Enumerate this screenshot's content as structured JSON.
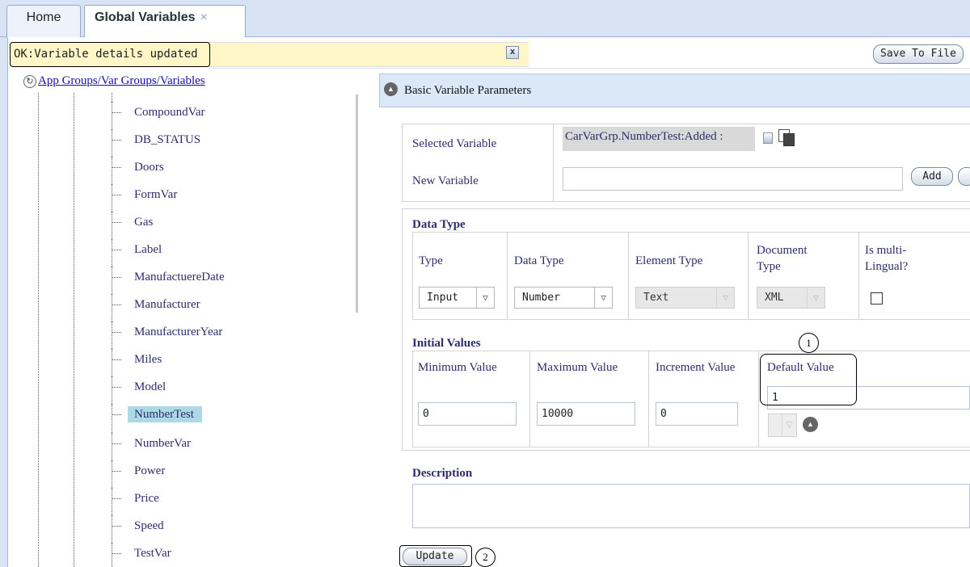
{
  "tabs": [
    {
      "label": "Home"
    },
    {
      "label": "Global Variables",
      "close": "×"
    }
  ],
  "status": {
    "message": "OK:Variable details updated",
    "dismiss": "x"
  },
  "toolbar": {
    "save_label": "Save To File"
  },
  "tree": {
    "root_label": "App Groups/Var Groups/Variables",
    "items": [
      {
        "label": "CompoundVar"
      },
      {
        "label": "DB_STATUS"
      },
      {
        "label": "Doors"
      },
      {
        "label": "FormVar"
      },
      {
        "label": "Gas"
      },
      {
        "label": "Label"
      },
      {
        "label": "ManufactuereDate"
      },
      {
        "label": "Manufacturer"
      },
      {
        "label": "ManufacturerYear"
      },
      {
        "label": "Miles"
      },
      {
        "label": "Model"
      },
      {
        "label": "NumberTest",
        "selected": true
      },
      {
        "label": "NumberVar"
      },
      {
        "label": "Power"
      },
      {
        "label": "Price"
      },
      {
        "label": "Speed"
      },
      {
        "label": "TestVar"
      }
    ]
  },
  "panel": {
    "title": "Basic Variable Parameters",
    "selected_variable_label": "Selected Variable",
    "selected_variable_value": "CarVarGrp.NumberTest:Added :",
    "new_variable_label": "New Variable",
    "new_variable_value": "",
    "add_label": "Add"
  },
  "data_type": {
    "title": "Data Type",
    "columns": {
      "type": "Type",
      "data_type": "Data Type",
      "element_type": "Element Type",
      "document_type_line1": "Document",
      "document_type_line2": "Type",
      "multilingual_line1": "Is multi-",
      "multilingual_line2": "Lingual?"
    },
    "values": {
      "type": "Input",
      "data_type": "Number",
      "element_type": "Text",
      "document_type": "XML",
      "multilingual": false
    }
  },
  "initial_values": {
    "title": "Initial Values",
    "columns": {
      "min": "Minimum Value",
      "max": "Maximum Value",
      "increment": "Increment Value",
      "default": "Default Value"
    },
    "values": {
      "min": "0",
      "max": "10000",
      "increment": "0",
      "default": "1"
    }
  },
  "description": {
    "title": "Description",
    "value": ""
  },
  "actions": {
    "update_label": "Update"
  },
  "callouts": {
    "one": "1",
    "two": "2"
  },
  "icons": {
    "collapse": "chevron-up-circle-icon",
    "tree_root": "refresh-icon",
    "dropdown": "chevron-down-icon"
  }
}
